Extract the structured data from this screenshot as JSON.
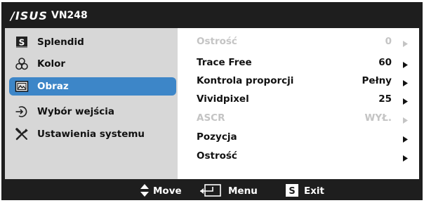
{
  "header": {
    "brand": "/ISUS",
    "model": "VN248"
  },
  "sidebar": {
    "items": [
      {
        "label": "Splendid",
        "icon": "s-box-icon"
      },
      {
        "label": "Kolor",
        "icon": "color-circles-icon"
      },
      {
        "label": "Obraz",
        "icon": "picture-icon",
        "selected": true
      },
      {
        "label": "Wybór wejścia",
        "icon": "input-icon"
      },
      {
        "label": "Ustawienia systemu",
        "icon": "tools-icon"
      }
    ]
  },
  "settings": [
    {
      "name": "Ostrość",
      "value": "0",
      "disabled": true
    },
    {
      "name": "Trace Free",
      "value": "60",
      "disabled": false
    },
    {
      "name": "Kontrola proporcji",
      "value": "Pełny",
      "disabled": false
    },
    {
      "name": "Vividpixel",
      "value": "25",
      "disabled": false
    },
    {
      "name": "ASCR",
      "value": "WYŁ.",
      "disabled": true
    },
    {
      "name": "Pozycja",
      "value": "",
      "disabled": false
    },
    {
      "name": "Ostrość",
      "value": "",
      "disabled": false
    }
  ],
  "footer": {
    "move": {
      "label": "Move",
      "icon": "up-down-arrows-icon"
    },
    "menu": {
      "label": "Menu",
      "icon": "enter-icon"
    },
    "exit": {
      "label": "Exit",
      "icon": "s-box-icon"
    }
  },
  "colors": {
    "background": "#1e1e1e",
    "sidebar": "#d7d7d7",
    "selected": "#3d86c8",
    "disabled_text": "#c4c4c4"
  }
}
